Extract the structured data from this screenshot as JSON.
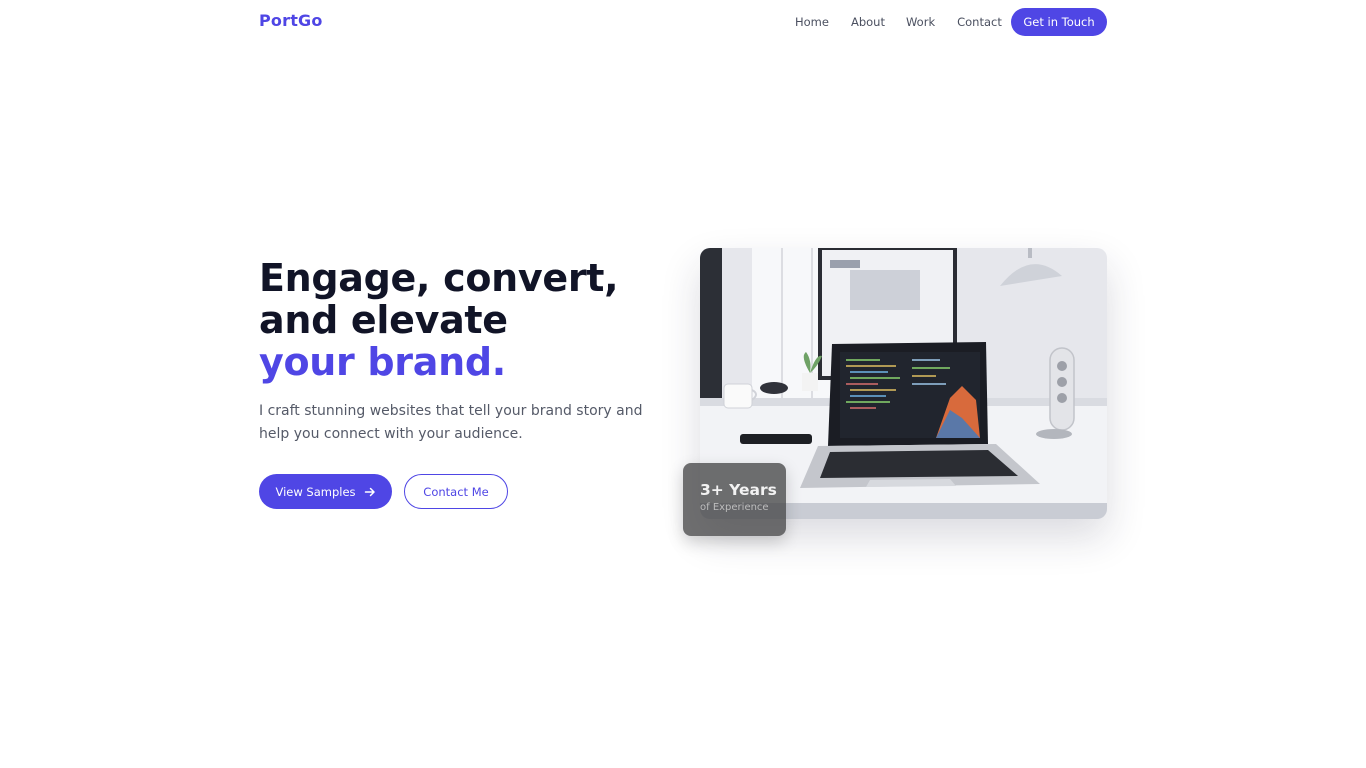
{
  "nav": {
    "logo": "PortGo",
    "links": [
      "Home",
      "About",
      "Work",
      "Contact"
    ],
    "cta": "Get in Touch"
  },
  "hero": {
    "title_line1": "Engage, convert,",
    "title_line2": "and elevate",
    "title_accent": "your brand.",
    "subtitle": "I craft stunning websites that tell your brand story and help you connect with your audience.",
    "primary_button": "View Samples",
    "secondary_button": "Contact Me"
  },
  "badge": {
    "value": "3+ Years",
    "label": "of Experience"
  },
  "colors": {
    "accent": "#4f46e5",
    "heading": "#111427",
    "body_text": "#555a68"
  },
  "icons": {
    "primary_button_icon": "arrow-right-icon"
  },
  "image": {
    "subject": "laptop-on-desk-photo"
  }
}
